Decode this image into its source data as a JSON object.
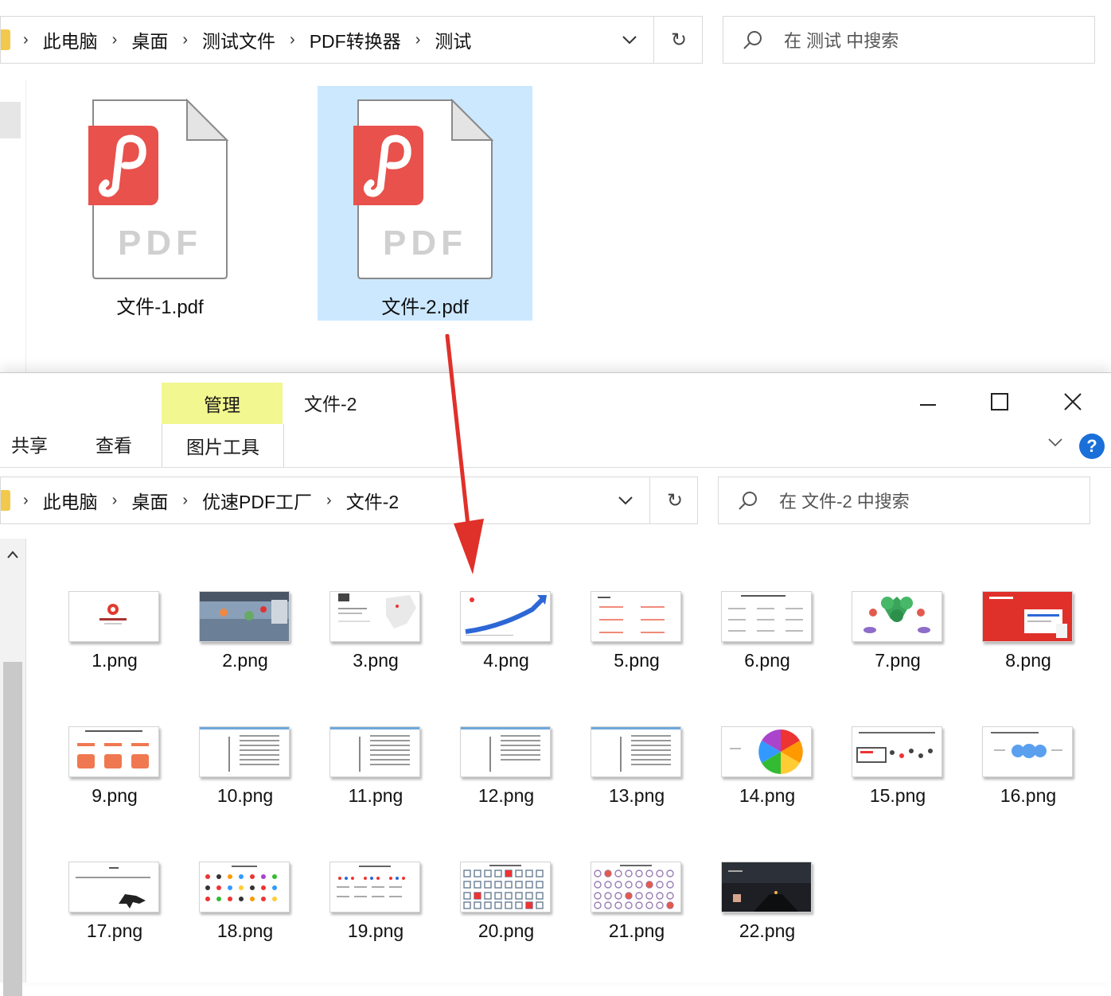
{
  "top_window": {
    "breadcrumb": [
      "此电脑",
      "桌面",
      "测试文件",
      "PDF转换器",
      "测试"
    ],
    "search_placeholder": "在 测试 中搜索",
    "files": [
      {
        "name": "文件-1.pdf",
        "icon_text": "PDF",
        "selected": false
      },
      {
        "name": "文件-2.pdf",
        "icon_text": "PDF",
        "selected": true
      }
    ]
  },
  "front_window": {
    "title": "文件-2",
    "context_tab": "管理",
    "ribbon_tabs": [
      "共享",
      "查看"
    ],
    "context_subtab": "图片工具",
    "breadcrumb": [
      "此电脑",
      "桌面",
      "优速PDF工厂",
      "文件-2"
    ],
    "search_placeholder": "在 文件-2 中搜索",
    "help_label": "?",
    "files": [
      "1.png",
      "2.png",
      "3.png",
      "4.png",
      "5.png",
      "6.png",
      "7.png",
      "8.png",
      "9.png",
      "10.png",
      "11.png",
      "12.png",
      "13.png",
      "14.png",
      "15.png",
      "16.png",
      "17.png",
      "18.png",
      "19.png",
      "20.png",
      "21.png",
      "22.png"
    ]
  },
  "colors": {
    "selection": "#cce8ff",
    "manage_tab": "#f3f78f",
    "pdf_red": "#e8514c",
    "arrow_red": "#e0302a",
    "help_blue": "#1a6fd9"
  }
}
